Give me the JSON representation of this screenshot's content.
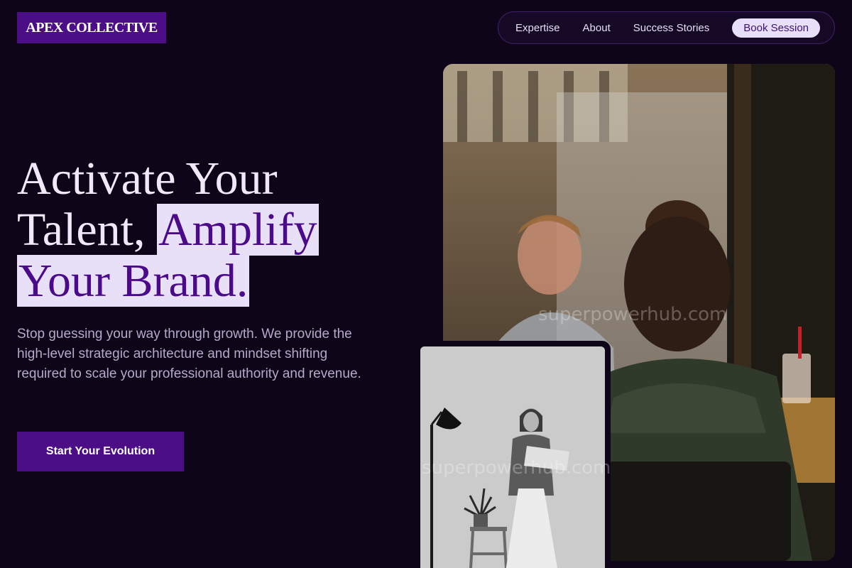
{
  "brand": {
    "logo_text": "APEX COLLECTIVE"
  },
  "nav": {
    "links": [
      "Expertise",
      "About",
      "Success Stories"
    ],
    "cta": "Book Session"
  },
  "hero": {
    "headline_line1": "Activate Your",
    "headline_plain": "Talent, ",
    "headline_highlight_1": "Amplify",
    "headline_highlight_2": "Your Brand.",
    "subtext": "Stop guessing your way through growth. We provide the high-level strategic architecture and mindset shifting required to scale your professional authority and revenue.",
    "cta": "Start Your Evolution"
  },
  "images": {
    "main": {
      "watermark": "superpowerhub.com"
    },
    "secondary": {
      "watermark": "superpowerhub.com"
    }
  },
  "colors": {
    "background": "#0f0518",
    "brand_purple": "#4b0e87",
    "highlight_bg": "#e8e0f7",
    "text_muted": "#b6a9c9"
  }
}
